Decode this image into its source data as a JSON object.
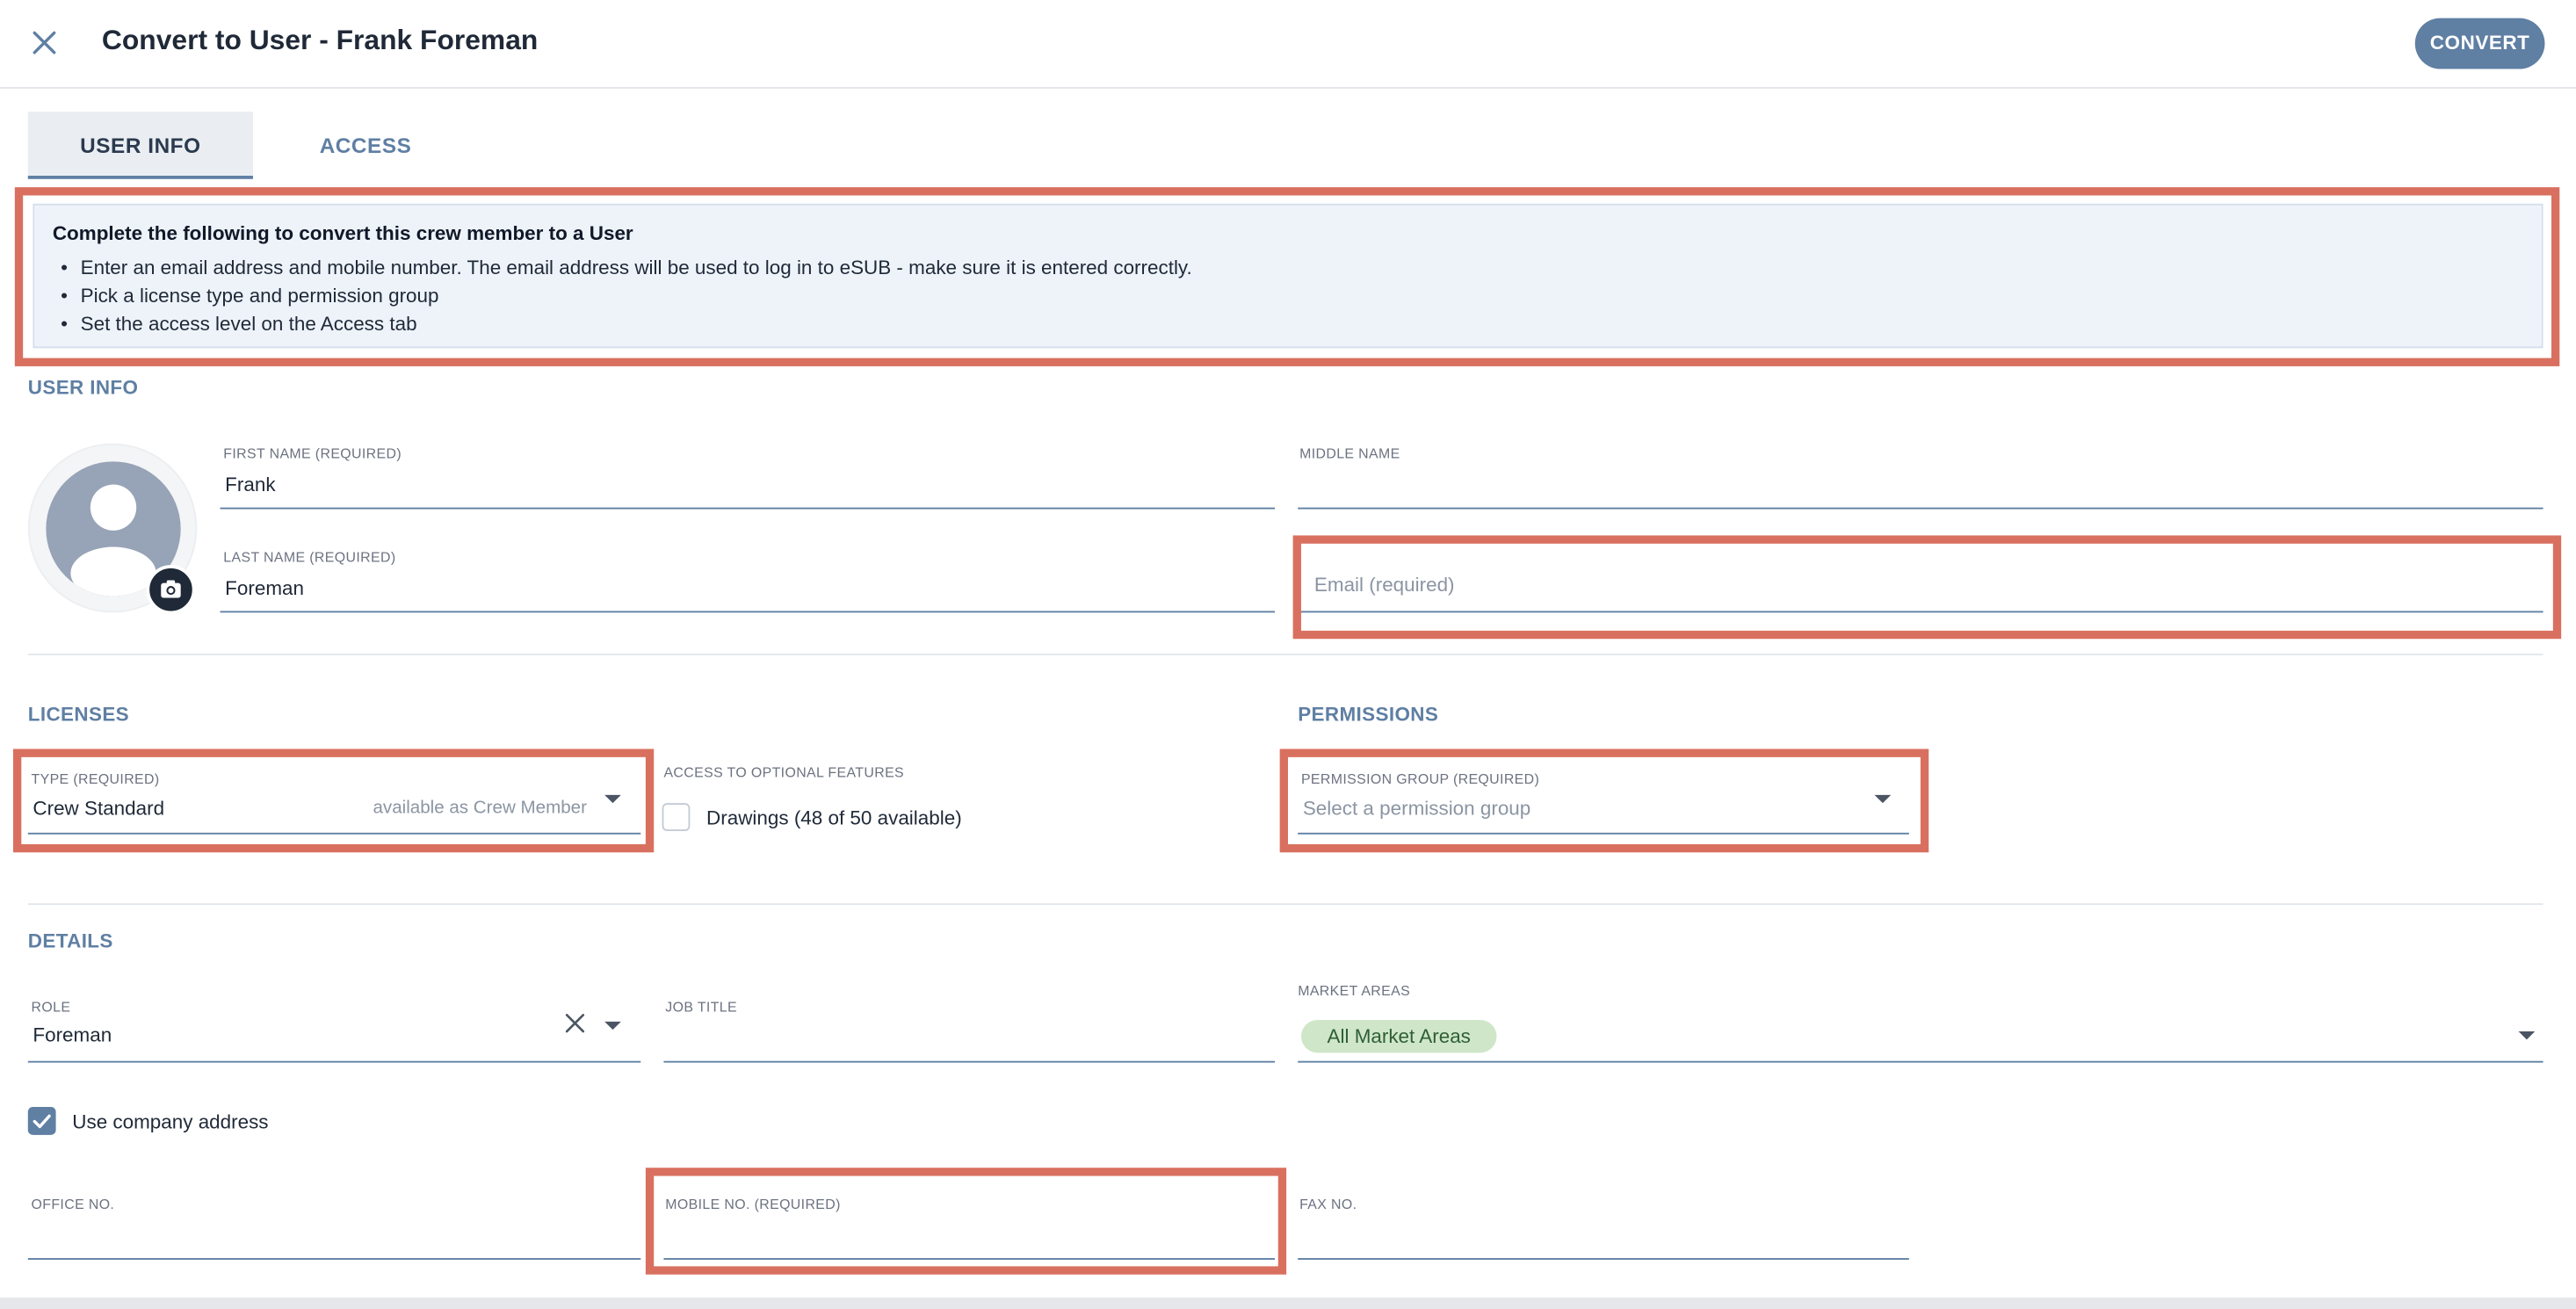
{
  "header": {
    "title": "Convert to User - Frank Foreman",
    "close_icon": "close-icon",
    "convert_label": "CONVERT"
  },
  "tabs": [
    {
      "label": "USER INFO",
      "active": true
    },
    {
      "label": "ACCESS",
      "active": false
    }
  ],
  "info_box": {
    "heading": "Complete the following to convert this crew member to a User",
    "items": [
      "Enter an email address and mobile number. The email address will be used to log in to eSUB - make sure it is entered correctly.",
      "Pick a license type and permission group",
      "Set the access level on the Access tab"
    ]
  },
  "user_info": {
    "section_label": "USER INFO",
    "first_name": {
      "label": "FIRST NAME (REQUIRED)",
      "value": "Frank"
    },
    "middle_name": {
      "label": "MIDDLE NAME",
      "value": ""
    },
    "last_name": {
      "label": "LAST NAME (REQUIRED)",
      "value": "Foreman"
    },
    "email": {
      "placeholder": "Email (required)",
      "value": ""
    }
  },
  "licenses": {
    "section_label": "LICENSES",
    "type": {
      "label": "TYPE (REQUIRED)",
      "value": "Crew Standard",
      "hint": "available as Crew Member"
    },
    "optional_features": {
      "label": "ACCESS TO OPTIONAL FEATURES",
      "drawings_label": "Drawings (48 of 50 available)",
      "checked": false
    }
  },
  "permissions": {
    "section_label": "PERMISSIONS",
    "group": {
      "label": "PERMISSION GROUP (REQUIRED)",
      "placeholder": "Select a permission group"
    }
  },
  "details": {
    "section_label": "DETAILS",
    "role": {
      "label": "ROLE",
      "value": "Foreman"
    },
    "job_title": {
      "label": "JOB TITLE",
      "value": ""
    },
    "market_areas": {
      "label": "MARKET AREAS",
      "chip": "All Market Areas"
    },
    "use_company_address": {
      "label": "Use company address",
      "checked": true
    },
    "office_no": {
      "label": "OFFICE NO.",
      "value": ""
    },
    "mobile_no": {
      "label": "MOBILE NO. (REQUIRED)",
      "value": ""
    },
    "fax_no": {
      "label": "FAX NO.",
      "value": ""
    }
  },
  "colors": {
    "accent": "#5f7fa3",
    "highlight": "#d9705f",
    "info_bg": "#eef3fa",
    "chip_bg": "#cfe6c9"
  }
}
